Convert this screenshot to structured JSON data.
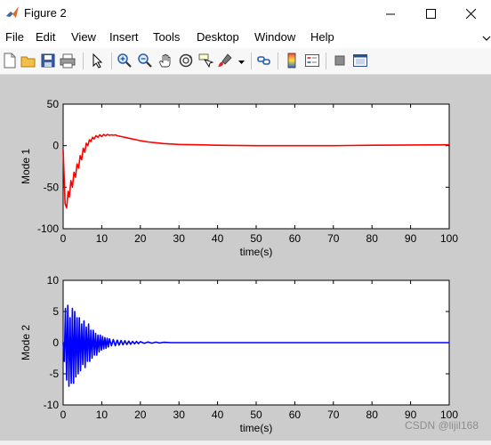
{
  "window": {
    "title": "Figure 2"
  },
  "menu": [
    "File",
    "Edit",
    "View",
    "Insert",
    "Tools",
    "Desktop",
    "Window",
    "Help"
  ],
  "toolbar_icons": [
    "new-figure-icon",
    "open-file-icon",
    "save-icon",
    "print-icon",
    "select-arrow-icon",
    "zoom-in-icon",
    "zoom-out-icon",
    "pan-hand-icon",
    "rotate-3d-icon",
    "data-cursor-icon",
    "brush-icon",
    "link-plot-icon",
    "colorbar-icon",
    "legend-icon",
    "hide-plot-tools-icon",
    "show-plot-tools-icon"
  ],
  "watermark": "CSDN @lijil168",
  "colors": {
    "mode1": "#ff0000",
    "mode2": "#0000ff",
    "figure_bg": "#cccccc",
    "axes_bg": "#ffffff"
  },
  "chart_data": [
    {
      "type": "line",
      "xlabel": "time(s)",
      "ylabel": "Mode 1",
      "xlim": [
        0,
        100
      ],
      "ylim": [
        -100,
        50
      ],
      "xticks": [
        0,
        10,
        20,
        30,
        40,
        50,
        60,
        70,
        80,
        90,
        100
      ],
      "yticks": [
        -100,
        -50,
        0,
        50
      ],
      "series": [
        {
          "color": "#ff0000",
          "x": [
            0,
            0.5,
            0.9,
            1.3,
            1.6,
            2,
            2.4,
            2.8,
            3.2,
            3.6,
            4,
            4.4,
            4.8,
            5.2,
            5.6,
            6,
            6.4,
            6.8,
            7.2,
            7.6,
            8,
            8.5,
            9,
            9.5,
            10,
            10.5,
            11,
            11.5,
            12,
            12.5,
            13,
            13.5,
            14,
            15,
            16,
            17,
            18,
            19,
            20,
            22,
            24,
            26,
            28,
            30,
            35,
            40,
            50,
            60,
            70,
            80,
            90,
            100
          ],
          "y": [
            -5,
            -70,
            -75,
            -55,
            -62,
            -42,
            -50,
            -32,
            -38,
            -22,
            -27,
            -12,
            -17,
            -3,
            -8,
            3,
            0,
            7,
            5,
            10,
            8,
            12,
            10,
            13,
            11,
            13.5,
            12,
            13.5,
            12.5,
            13,
            12.5,
            13,
            12,
            11,
            10,
            9,
            8,
            7,
            6,
            4.5,
            3.5,
            2.5,
            2,
            1.5,
            1,
            0.5,
            0,
            0,
            0,
            0.5,
            0.8,
            1
          ]
        }
      ]
    },
    {
      "type": "line",
      "xlabel": "time(s)",
      "ylabel": "Mode 2",
      "xlim": [
        0,
        100
      ],
      "ylim": [
        -10,
        10
      ],
      "xticks": [
        0,
        10,
        20,
        30,
        40,
        50,
        60,
        70,
        80,
        90,
        100
      ],
      "yticks": [
        -10,
        -5,
        0,
        5,
        10
      ],
      "series": [
        {
          "color": "#0000ff",
          "x": [
            0,
            0.3,
            0.6,
            0.9,
            1.2,
            1.5,
            1.8,
            2.1,
            2.4,
            2.7,
            3,
            3.3,
            3.6,
            3.9,
            4.2,
            4.5,
            4.8,
            5.1,
            5.4,
            5.7,
            6,
            6.3,
            6.6,
            6.9,
            7.2,
            7.5,
            7.8,
            8.1,
            8.4,
            8.7,
            9,
            9.3,
            9.6,
            9.9,
            10.2,
            10.5,
            10.8,
            11.1,
            11.4,
            11.7,
            12,
            12.5,
            13,
            13.5,
            14,
            14.5,
            15,
            15.5,
            16,
            16.5,
            17,
            17.5,
            18,
            18.5,
            19,
            19.5,
            20,
            21,
            22,
            23,
            24,
            25,
            26,
            28,
            30,
            40,
            50,
            60,
            70,
            80,
            90,
            100
          ],
          "y": [
            0,
            -3,
            5.5,
            -6,
            6,
            -7,
            4,
            -6.5,
            5.5,
            -6.5,
            5,
            -5.5,
            4,
            -5,
            4,
            -4.5,
            3,
            -3.5,
            3.5,
            -4,
            2.5,
            -3,
            3,
            -3,
            2,
            -2.5,
            2,
            -2,
            1.5,
            -2,
            1.2,
            -1.5,
            1.2,
            -1.2,
            1,
            -1,
            0.8,
            -0.9,
            0.7,
            -0.7,
            0.6,
            -0.5,
            0.5,
            -0.5,
            0.4,
            -0.4,
            0.35,
            -0.35,
            0.3,
            -0.3,
            0.25,
            -0.25,
            0.2,
            -0.2,
            0.2,
            -0.15,
            0.15,
            -0.1,
            0.1,
            -0.08,
            0.08,
            -0.05,
            0.05,
            0,
            0,
            0,
            0,
            0,
            0,
            0,
            0,
            0
          ]
        }
      ]
    }
  ]
}
